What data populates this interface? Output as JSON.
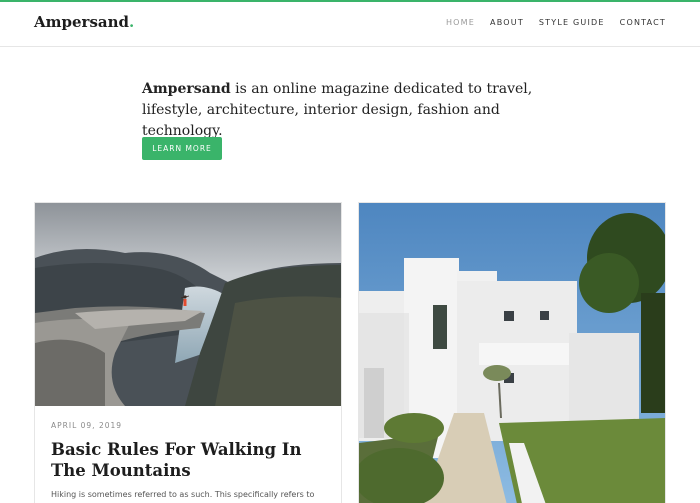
{
  "brand": {
    "name": "Ampersand",
    "dot": ".",
    "accent_color": "#3ab46a"
  },
  "nav": {
    "items": [
      {
        "label": "HOME",
        "active": true
      },
      {
        "label": "ABOUT",
        "active": false
      },
      {
        "label": "STYLE GUIDE",
        "active": false
      },
      {
        "label": "CONTACT",
        "active": false
      }
    ]
  },
  "intro": {
    "lead": "Ampersand",
    "text": " is an online magazine dedicated to travel, lifestyle, architecture, interior design, fashion and technology.",
    "button_label": "LEARN MORE"
  },
  "posts": [
    {
      "image_icon": "mountain-landscape-photo",
      "date": "APRIL 09, 2019",
      "title": "Basic Rules For Walking In The Mountains",
      "excerpt": "Hiking is sometimes referred to as such. This specifically refers to"
    },
    {
      "image_icon": "white-house-photo"
    }
  ]
}
